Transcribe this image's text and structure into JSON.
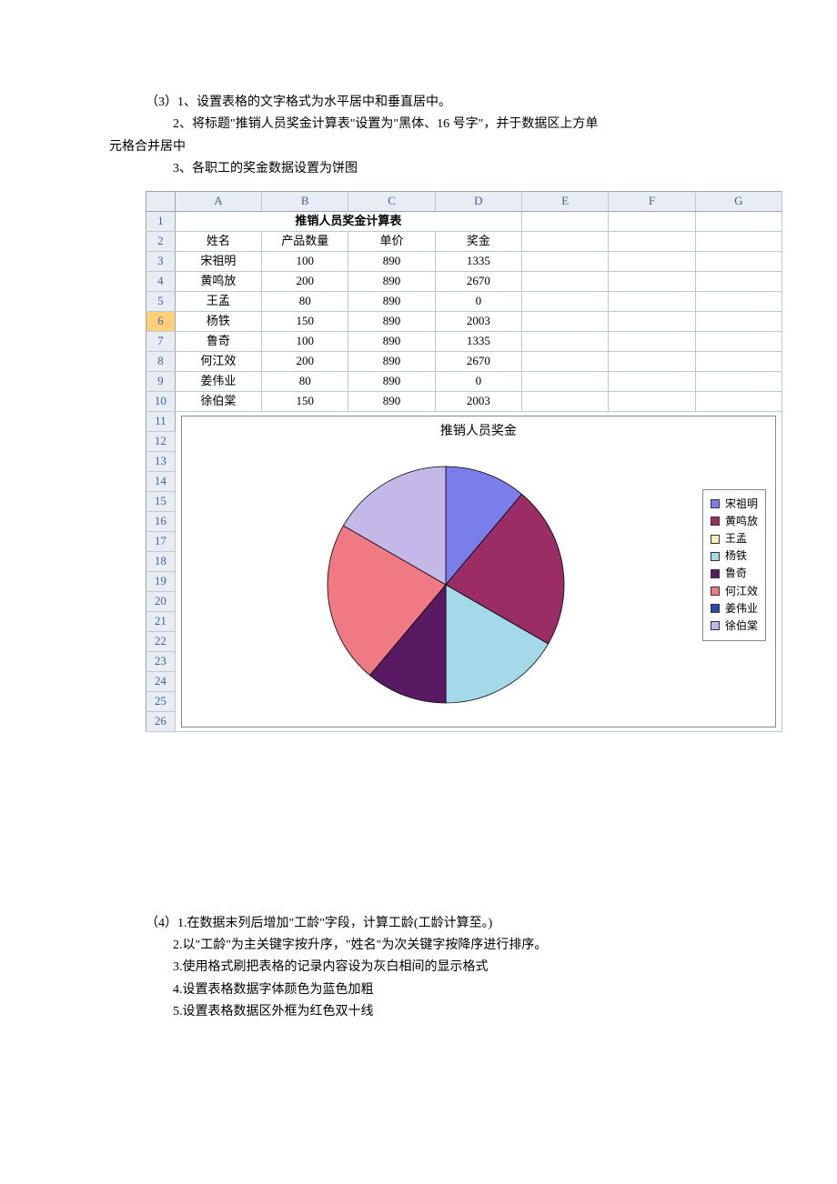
{
  "section1": {
    "line1": "（3）1、设置表格的文字格式为水平居中和垂直居中。",
    "line2a": "2、将标题\"推销人员奖金计算表\"设置为\"黑体、16 号字\"，并于数据区上方单",
    "line2b": "元格合并居中",
    "line3": "3、各职工的奖金数据设置为饼图"
  },
  "spreadsheet": {
    "col_headers": [
      "A",
      "B",
      "C",
      "D",
      "E",
      "F",
      "G"
    ],
    "row_headers": [
      "1",
      "2",
      "3",
      "4",
      "5",
      "6",
      "7",
      "8",
      "9",
      "10",
      "11",
      "12",
      "13",
      "14",
      "15",
      "16",
      "17",
      "18",
      "19",
      "20",
      "21",
      "22",
      "23",
      "24",
      "25",
      "26"
    ],
    "selected_row": "6",
    "title": "推销人员奖金计算表",
    "headers": [
      "姓名",
      "产品数量",
      "单价",
      "奖金"
    ],
    "rows": [
      {
        "name": "宋祖明",
        "qty": "100",
        "price": "890",
        "bonus": "1335"
      },
      {
        "name": "黄鸣放",
        "qty": "200",
        "price": "890",
        "bonus": "2670"
      },
      {
        "name": "王孟",
        "qty": "80",
        "price": "890",
        "bonus": "0"
      },
      {
        "name": "杨铁",
        "qty": "150",
        "price": "890",
        "bonus": "2003"
      },
      {
        "name": "鲁奇",
        "qty": "100",
        "price": "890",
        "bonus": "1335"
      },
      {
        "name": "何江效",
        "qty": "200",
        "price": "890",
        "bonus": "2670"
      },
      {
        "name": "姜伟业",
        "qty": "80",
        "price": "890",
        "bonus": "0"
      },
      {
        "name": "徐伯棠",
        "qty": "150",
        "price": "890",
        "bonus": "2003"
      }
    ]
  },
  "chart_data": {
    "type": "pie",
    "title": "推销人员奖金",
    "categories": [
      "宋祖明",
      "黄鸣放",
      "王孟",
      "杨铁",
      "鲁奇",
      "何江效",
      "姜伟业",
      "徐伯棠"
    ],
    "values": [
      1335,
      2670,
      0,
      2003,
      1335,
      2670,
      0,
      2003
    ],
    "colors": [
      "#7a7eea",
      "#9a2d63",
      "#f5f0b5",
      "#a3d9e8",
      "#5a1a63",
      "#ef7a84",
      "#2a4aa8",
      "#c3b8e8"
    ]
  },
  "section2": {
    "line1": "（4）1.在数据末列后增加\"工龄\"字段，计算工龄(工龄计算至。)",
    "line2": "2.以\"工龄\"为主关键字按升序，\"姓名\"为次关键字按降序进行排序。",
    "line3": "3.使用格式刷把表格的记录内容设为灰白相间的显示格式",
    "line4": "4.设置表格数据字体颜色为蓝色加粗",
    "line5": "5.设置表格数据区外框为红色双十线"
  }
}
